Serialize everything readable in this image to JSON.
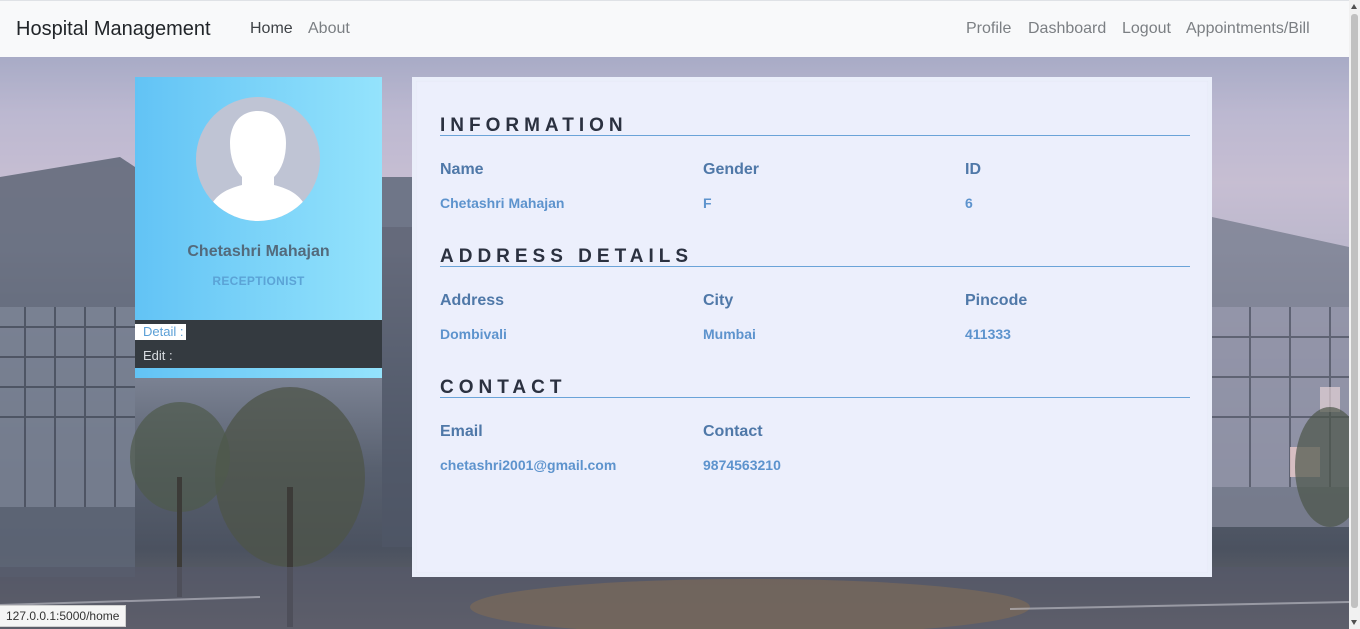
{
  "navbar": {
    "brand": "Hospital Management",
    "left_links": [
      {
        "label": "Home"
      },
      {
        "label": "About"
      }
    ],
    "right_links": [
      {
        "label": "Profile"
      },
      {
        "label": "Dashboard"
      },
      {
        "label": "Logout"
      },
      {
        "label": "Appointments/Bill"
      }
    ]
  },
  "profile": {
    "name": "Chetashri Mahajan",
    "role": "RECEPTIONIST",
    "menu": {
      "detail": "Detail :",
      "edit": "Edit :"
    }
  },
  "information": {
    "title": "INFORMATION",
    "fields": [
      {
        "label": "Name",
        "value": "Chetashri Mahajan"
      },
      {
        "label": "Gender",
        "value": "F"
      },
      {
        "label": "ID",
        "value": "6"
      }
    ]
  },
  "address": {
    "title": "ADDRESS DETAILS",
    "fields": [
      {
        "label": "Address",
        "value": "Dombivali"
      },
      {
        "label": "City",
        "value": "Mumbai"
      },
      {
        "label": "Pincode",
        "value": "411333"
      }
    ]
  },
  "contact": {
    "title": "CONTACT",
    "fields": [
      {
        "label": "Email",
        "value": "chetashri2001@gmail.com"
      },
      {
        "label": "Contact",
        "value": "9874563210"
      }
    ]
  },
  "status_bar": {
    "url": "127.0.0.1:5000/home"
  }
}
